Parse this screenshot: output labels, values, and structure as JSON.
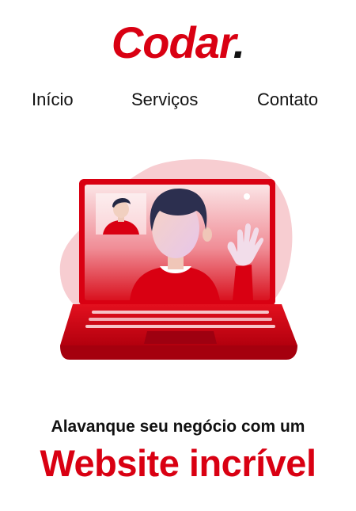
{
  "brand": {
    "name": "Codar",
    "dot": ".",
    "accent_color": "#d90012"
  },
  "nav": {
    "items": [
      {
        "label": "Início"
      },
      {
        "label": "Serviços"
      },
      {
        "label": "Contato"
      }
    ]
  },
  "hero": {
    "illustration": "laptop-video-call-illustration"
  },
  "headline": {
    "tagline": "Alavanque seu negócio com um",
    "title": "Website incrível"
  }
}
